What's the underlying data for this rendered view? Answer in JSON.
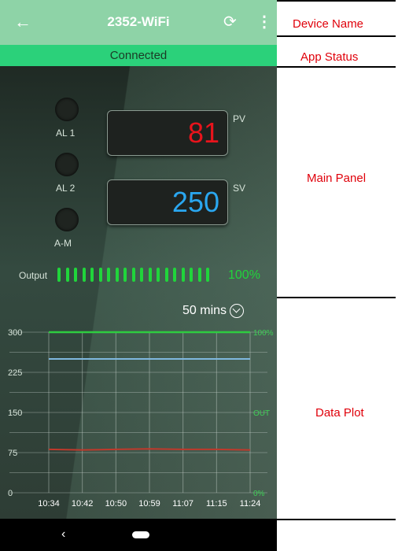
{
  "app_bar": {
    "back_icon": "arrow-left-icon",
    "title": "2352-WiFi",
    "refresh_icon": "refresh-icon",
    "more_icon": "more-vert-icon"
  },
  "status": {
    "text": "Connected"
  },
  "panel": {
    "alarms": [
      {
        "label": "AL 1"
      },
      {
        "label": "AL 2"
      },
      {
        "label": "A-M"
      }
    ],
    "pv": {
      "value": "81",
      "tag": "PV",
      "color": "#e8141c"
    },
    "sv": {
      "value": "250",
      "tag": "SV",
      "color": "#2aa7f0"
    },
    "output": {
      "label": "Output",
      "percent": "100%",
      "level": 1.0,
      "color": "#20d53b"
    }
  },
  "plot": {
    "time_span": "50 mins",
    "chevron_icon": "chevron-down-circle-icon"
  },
  "chart_data": {
    "type": "line",
    "x": [
      "10:34",
      "10:42",
      "10:50",
      "10:59",
      "11:07",
      "11:15",
      "11:24"
    ],
    "y_ticks": [
      "300",
      "225",
      "150",
      "75",
      "0"
    ],
    "right_ticks": [
      "100%",
      "OUT",
      "0%"
    ],
    "ylim": [
      0,
      300
    ],
    "series": [
      {
        "values": [
          300,
          300,
          300,
          300,
          300,
          300,
          300
        ],
        "color": "#2ecc40"
      },
      {
        "values": [
          250,
          250,
          250,
          250,
          250,
          250,
          250
        ],
        "color": "#7fb8df"
      },
      {
        "values": [
          81,
          80,
          81,
          82,
          81,
          81,
          80
        ],
        "color": "#c0392b"
      }
    ],
    "grid": true
  },
  "nav": {
    "back_icon": "nav-back-icon",
    "home_icon": "nav-home-pill-icon"
  },
  "annotations": {
    "device_name": "Device Name",
    "app_status": "App Status",
    "main_panel": "Main Panel",
    "data_plot": "Data Plot"
  }
}
